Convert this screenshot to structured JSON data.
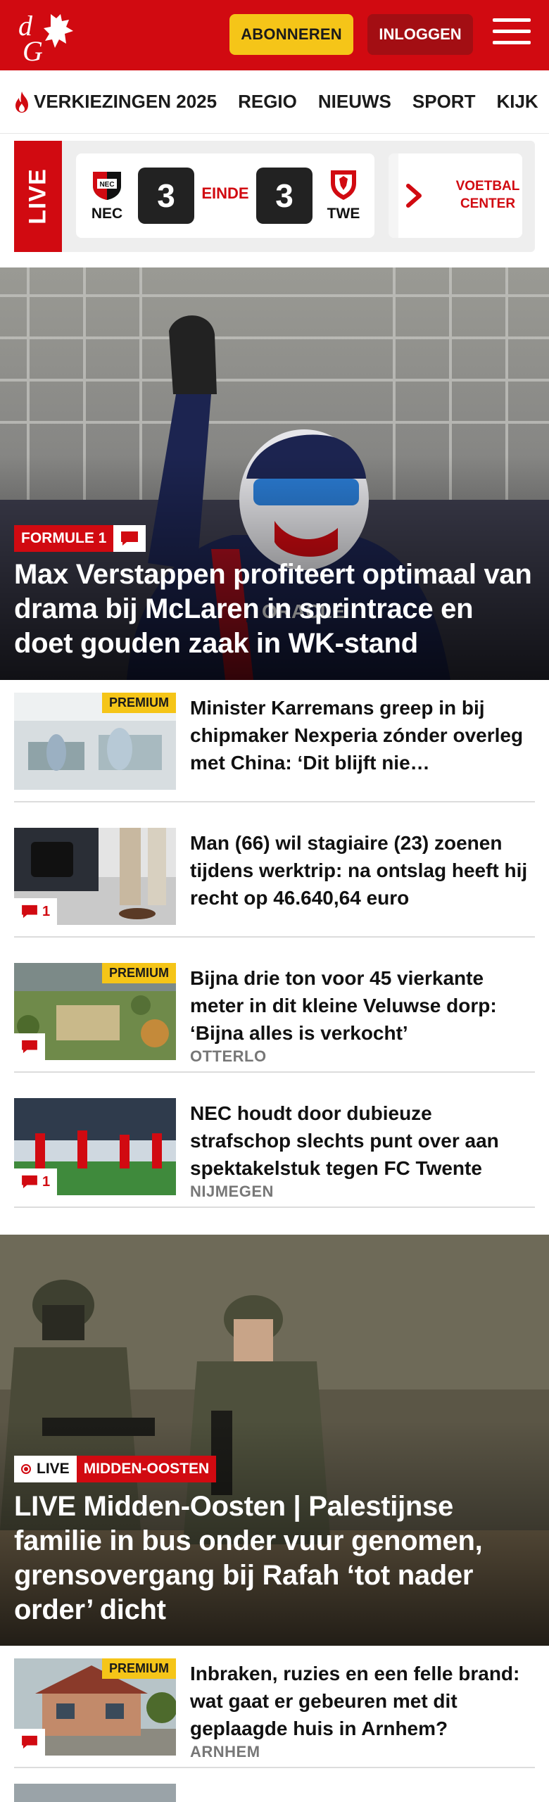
{
  "header": {
    "logo_text": "dG",
    "subscribe_label": "ABONNEREN",
    "login_label": "INLOGGEN",
    "brand_color": "#d10a11"
  },
  "nav": {
    "items": [
      "VERKIEZINGEN 2025",
      "REGIO",
      "NIEUWS",
      "SPORT",
      "KIJK"
    ]
  },
  "live_widget": {
    "live_label": "LIVE",
    "home_team": "NEC",
    "away_team": "TWE",
    "home_score": "3",
    "away_score": "3",
    "status": "EINDE",
    "center_line1": "VOETBAL",
    "center_line2": "CENTER"
  },
  "hero": {
    "category": "FORMULE 1",
    "title": "Max Verstappen profiteert optimaal van drama bij McLaren in sprintrace en doet gouden zaak in WK-stand"
  },
  "articles": [
    {
      "premium": "PREMIUM",
      "title": "Minister Karremans greep in bij chipmaker Nexperia zónder overleg met China: ‘Dit blijft nie…",
      "location": "",
      "comments": ""
    },
    {
      "premium": "",
      "title": "Man (66) wil stagiaire (23) zoenen tijdens werktrip: na ontslag heeft hij recht op 46.640,64 euro",
      "location": "",
      "comments": "1"
    },
    {
      "premium": "PREMIUM",
      "title": "Bijna drie ton voor 45 vierkante meter in dit kleine Veluwse dorp: ‘Bijna alles is verkocht’",
      "location": "OTTERLO",
      "comments": ""
    },
    {
      "premium": "",
      "title": "NEC houdt door dubieuze strafschop slechts punt over aan spektakelstuk tegen FC Twente",
      "location": "NIJMEGEN",
      "comments": "1"
    }
  ],
  "hero2": {
    "live_label": "LIVE",
    "category": "MIDDEN-OOSTEN",
    "title": "LIVE Midden-Oosten | Palestijnse familie in bus onder vuur genomen, grensovergang bij Rafah ‘tot nader order’ dicht"
  },
  "articles2": [
    {
      "premium": "PREMIUM",
      "title": "Inbraken, ruzies en een felle brand: wat gaat er gebeuren met dit geplaagde huis in Arnhem?",
      "location": "ARNHEM",
      "comments": ""
    }
  ]
}
